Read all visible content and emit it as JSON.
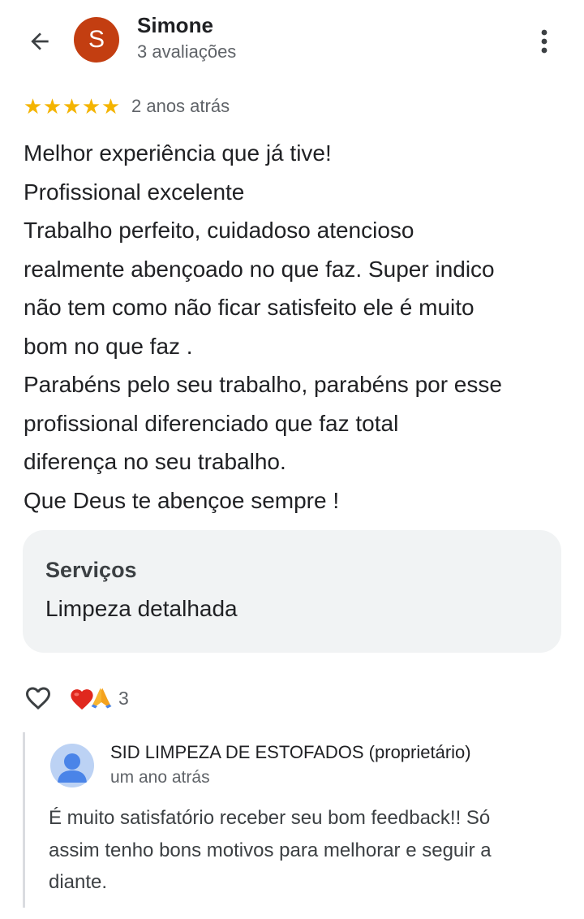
{
  "header": {
    "avatar_letter": "S",
    "reviewer_name": "Simone",
    "reviewer_reviews": "3 avaliações",
    "avatar_color": "#c33e11"
  },
  "review": {
    "stars": [
      "★",
      "★",
      "★",
      "★",
      "★"
    ],
    "rating": 5,
    "date": "2 anos atrás",
    "lines": [
      "Melhor experiência que já tive!",
      "Profissional excelente",
      "Trabalho perfeito, cuidadoso atencioso",
      "realmente abençoado no que faz. Super indico",
      "não tem como não ficar satisfeito ele é muito",
      "bom no que faz .",
      "Parabéns pelo seu trabalho, parabéns por esse",
      "profissional diferenciado que faz total",
      "diferença no seu trabalho.",
      "Que Deus te abençoe sempre !"
    ]
  },
  "services": {
    "title": "Serviços",
    "value": "Limpeza detalhada"
  },
  "reactions": {
    "count": "3",
    "emojis": [
      "heart-emoji",
      "praying-hands-emoji"
    ]
  },
  "owner_reply": {
    "name": "SID LIMPEZA DE ESTOFADOS (proprietário)",
    "date": "um ano atrás",
    "lines": [
      "É muito satisfatório receber seu bom feedback!! Só",
      "assim tenho bons motivos para melhorar e seguir a",
      "diante."
    ]
  },
  "colors": {
    "star": "#f4b400",
    "text_primary": "#202124",
    "text_secondary": "#5f6368",
    "services_bg": "#f1f3f4",
    "owner_avatar_bg": "#bcd2f4",
    "owner_avatar_fg": "#4a84e8"
  }
}
